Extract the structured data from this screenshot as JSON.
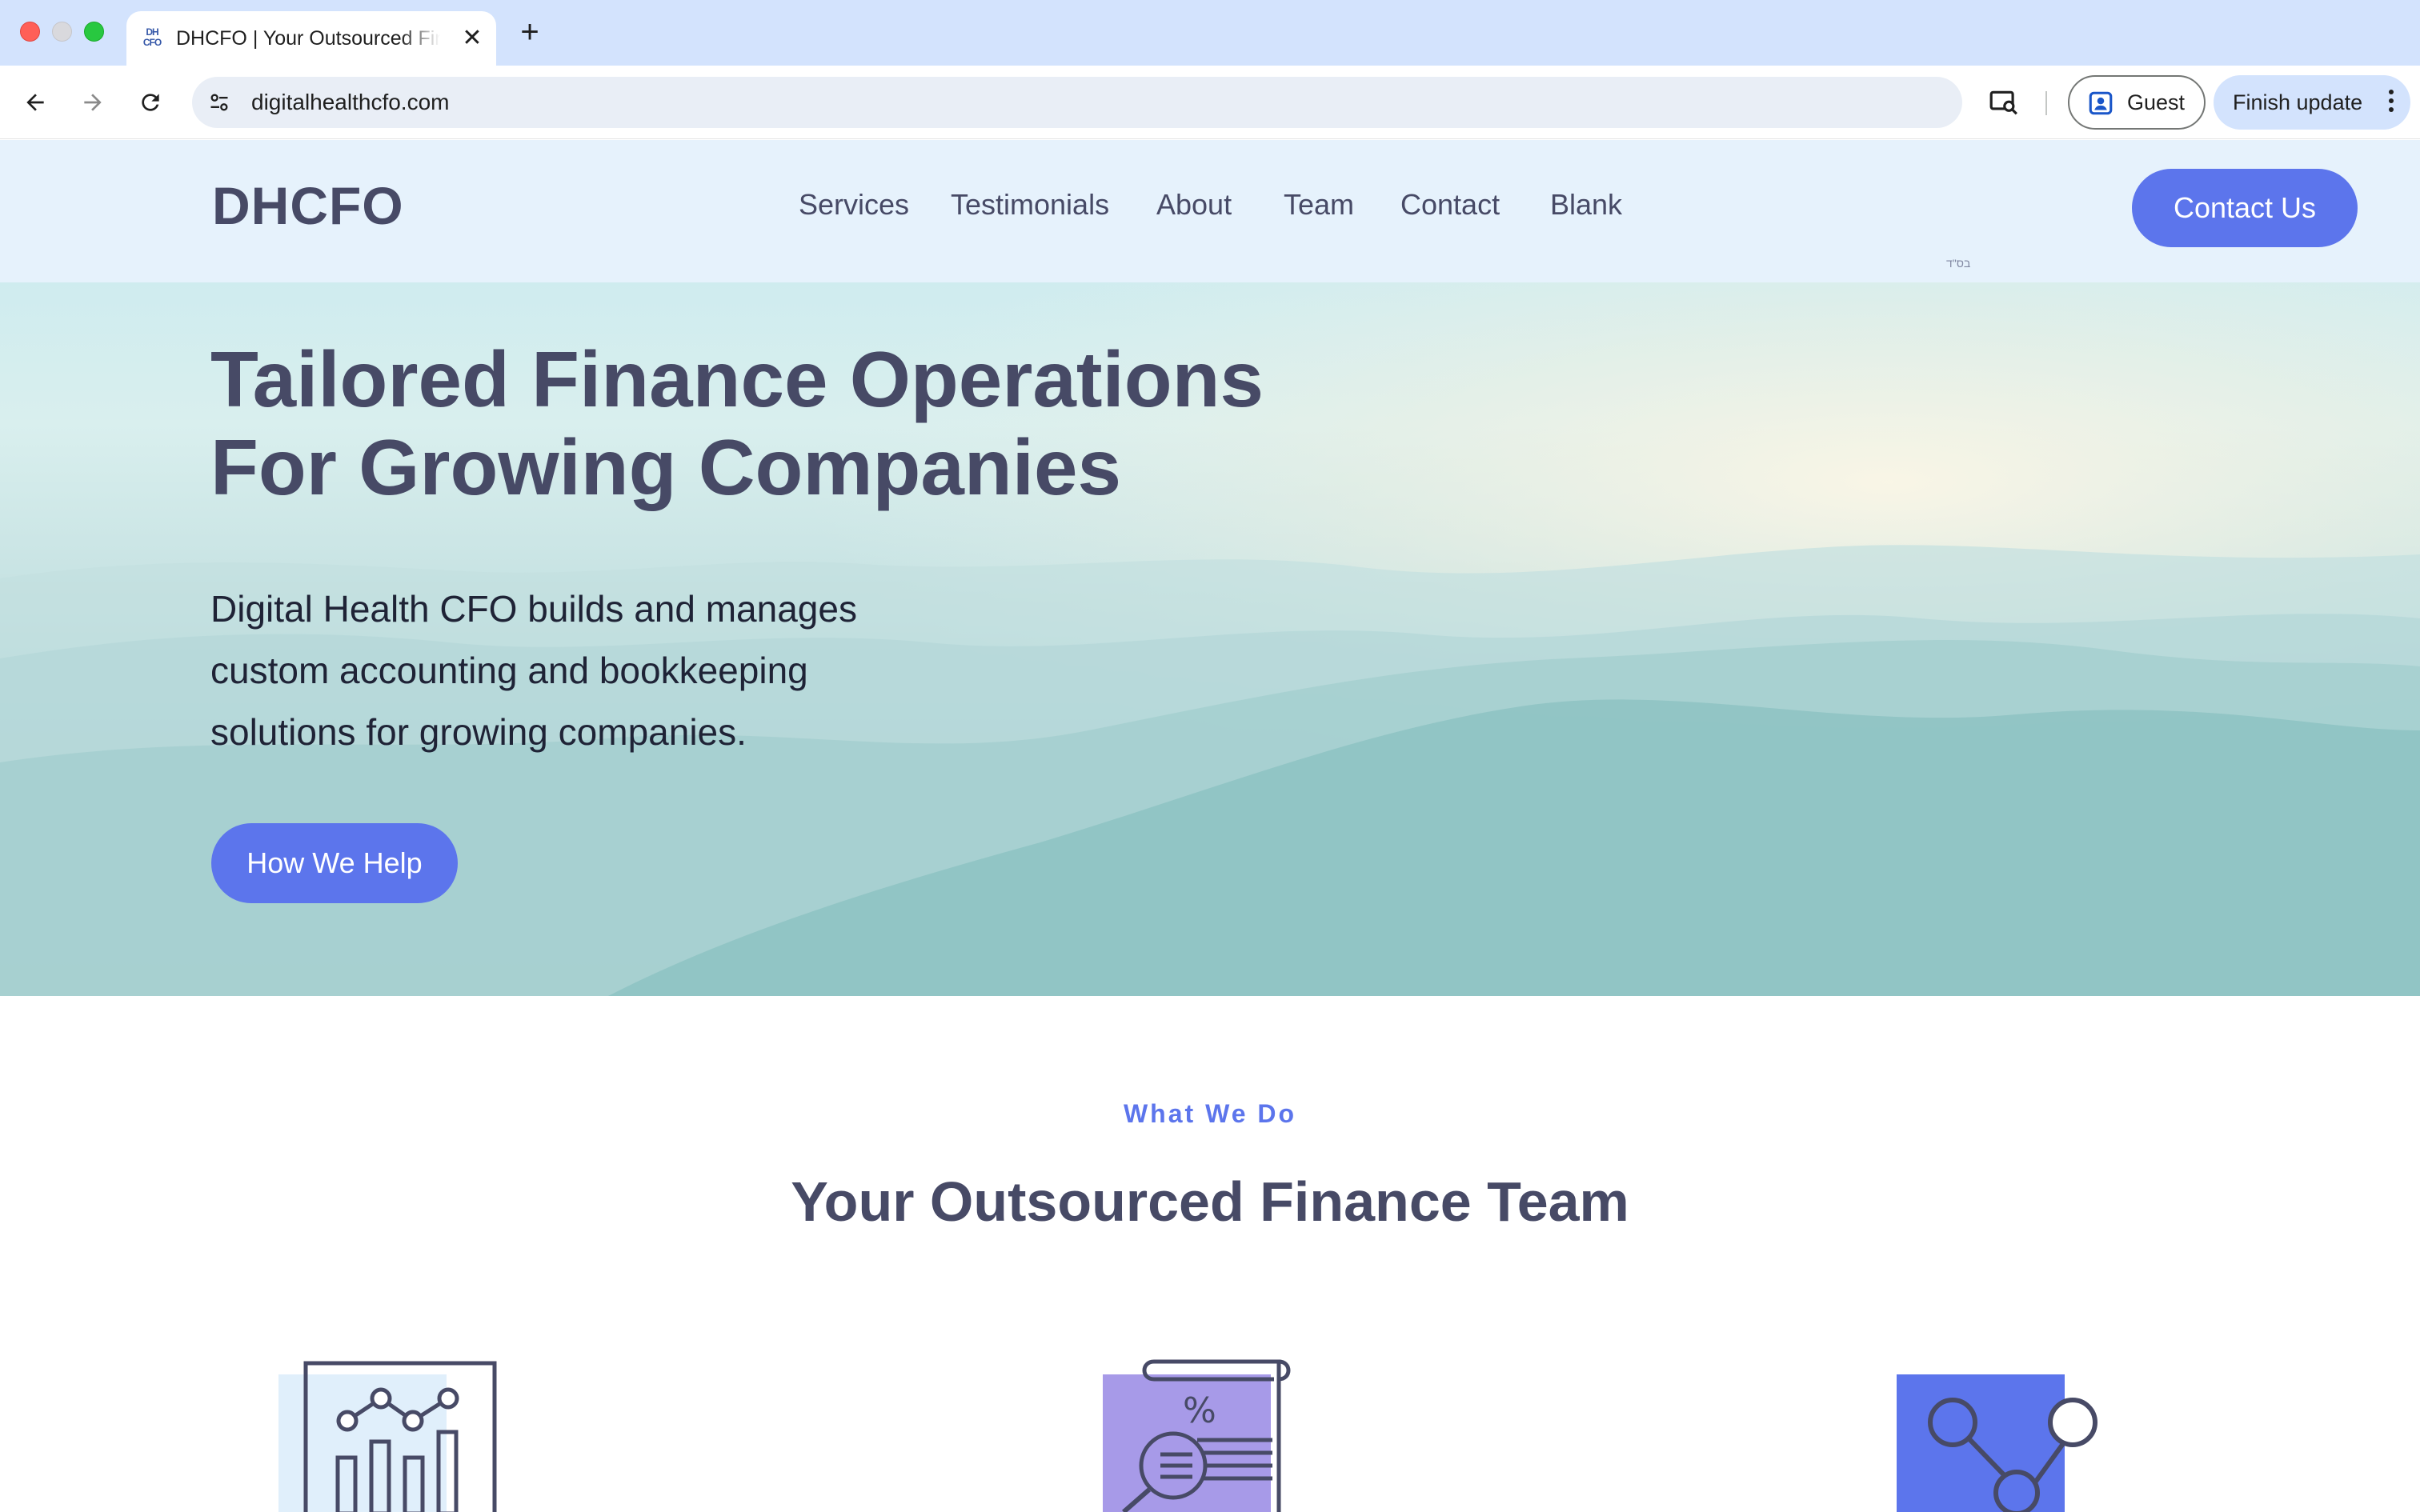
{
  "browser": {
    "tab": {
      "title": "DHCFO | Your Outsourced Finance Team",
      "favicon_text": "DH CFO",
      "close_glyph": "✕"
    },
    "new_tab_glyph": "+",
    "url": "digitalhealthcfo.com",
    "profile_label": "Guest",
    "update_label": "Finish update"
  },
  "site": {
    "logo": "DHCFO",
    "nav": [
      "Services",
      "Testimonials",
      "About",
      "Team",
      "Contact",
      "Blank"
    ],
    "cta": "Contact Us",
    "mark": "בס\"ד"
  },
  "hero": {
    "title_lines": [
      "Tailored Finance Operations",
      "For Growing Companies"
    ],
    "body_lines": [
      "Digital Health CFO builds and manages",
      "custom accounting and bookkeeping",
      "solutions for growing companies."
    ],
    "button": "How We Help"
  },
  "section": {
    "eyebrow": "What We Do",
    "title": "Your Outsourced Finance Team",
    "icons": [
      "analytics-chart-icon",
      "tax-document-search-icon",
      "network-nodes-icon"
    ]
  },
  "colors": {
    "brand_text": "#474a66",
    "accent": "#5c75ec",
    "header_bg": "#e6f2fc",
    "tabbar_bg": "#d3e3fd"
  }
}
